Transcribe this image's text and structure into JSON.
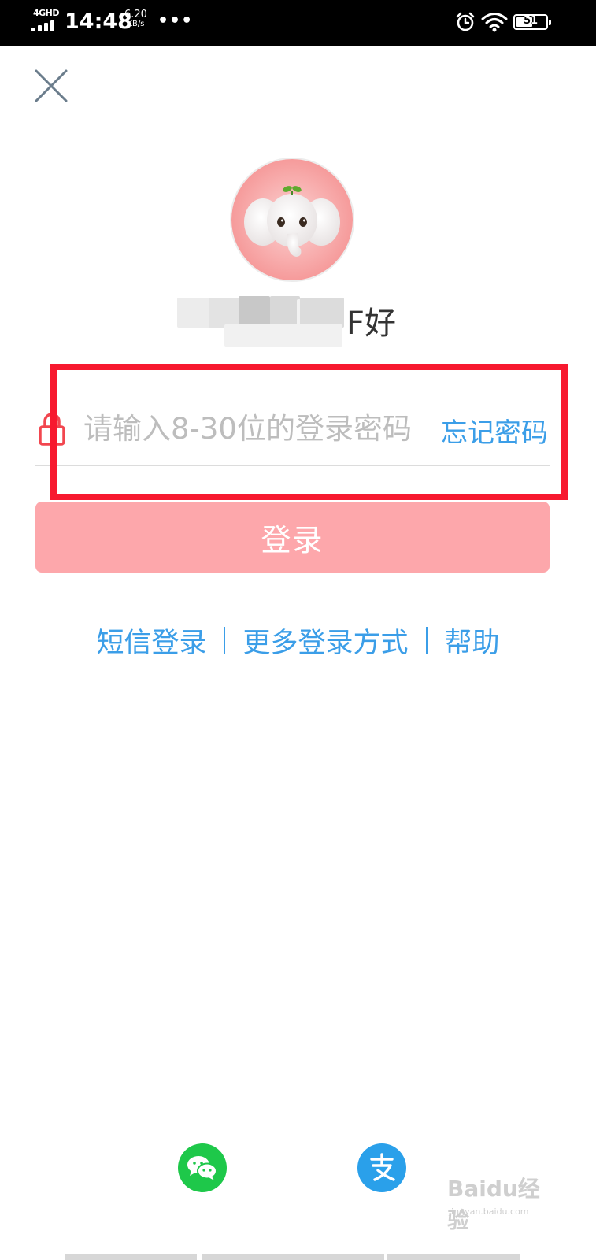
{
  "status_bar": {
    "network": "4GHD",
    "time": "14:48",
    "speed_value": "6.20",
    "speed_unit": "KB/s",
    "more": "•••",
    "battery_level": "51"
  },
  "login": {
    "greeting": "F好",
    "password_placeholder": "请输入8-30位的登录密码",
    "forgot_password": "忘记密码",
    "login_button": "登录"
  },
  "links": {
    "sms_login": "短信登录",
    "more_methods": "更多登录方式",
    "help": "帮助"
  },
  "social": {
    "wechat_icon": "wechat-icon",
    "alipay_icon": "alipay-icon"
  },
  "watermark": {
    "brand": "Baidu经验",
    "url": "jingyan.baidu.com"
  },
  "colors": {
    "accent_blue": "#3b9ee8",
    "login_button": "#fda7ab",
    "highlight_red": "#f7192f",
    "lock_red": "#f2464f",
    "wechat_green": "#1ec84a",
    "alipay_blue": "#2aa0ea"
  }
}
